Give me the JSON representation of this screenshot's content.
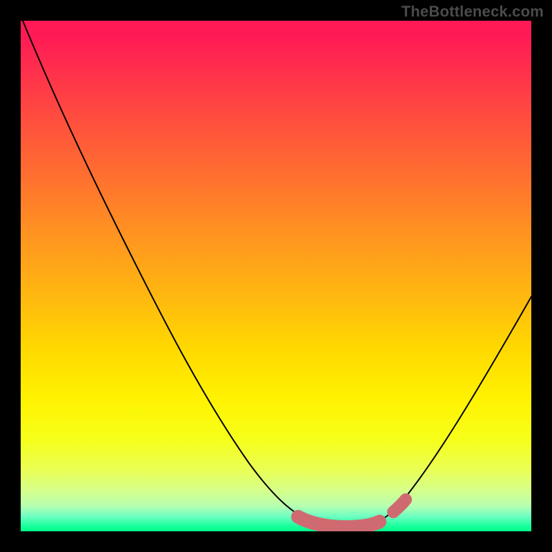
{
  "watermark": "TheBottleneck.com",
  "chart_data": {
    "type": "line",
    "title": "",
    "xlabel": "",
    "ylabel": "",
    "xlim": [
      0,
      100
    ],
    "ylim": [
      0,
      100
    ],
    "grid": false,
    "series": [
      {
        "name": "bottleneck-curve",
        "color": "#000000",
        "x": [
          0,
          5,
          10,
          15,
          20,
          25,
          30,
          35,
          40,
          45,
          50,
          53,
          56,
          60,
          64,
          68,
          70,
          75,
          80,
          85,
          90,
          95,
          100
        ],
        "y": [
          100,
          92,
          84,
          76,
          68,
          60,
          52,
          44,
          36,
          28,
          20,
          14,
          10,
          6,
          4,
          4,
          5,
          8,
          14,
          22,
          32,
          42,
          52
        ]
      },
      {
        "name": "optimal-band",
        "color": "#d66a6a",
        "x": [
          54,
          56,
          58,
          60,
          62,
          64,
          66,
          68,
          70,
          72
        ],
        "y": [
          8,
          6,
          5,
          4,
          4,
          4,
          4,
          4,
          5,
          6
        ]
      }
    ],
    "background_gradient_stops": [
      {
        "pct": 0,
        "color": "#ff1a55"
      },
      {
        "pct": 50,
        "color": "#ffd800"
      },
      {
        "pct": 88,
        "color": "#eaff55"
      },
      {
        "pct": 100,
        "color": "#00ff88"
      }
    ]
  }
}
